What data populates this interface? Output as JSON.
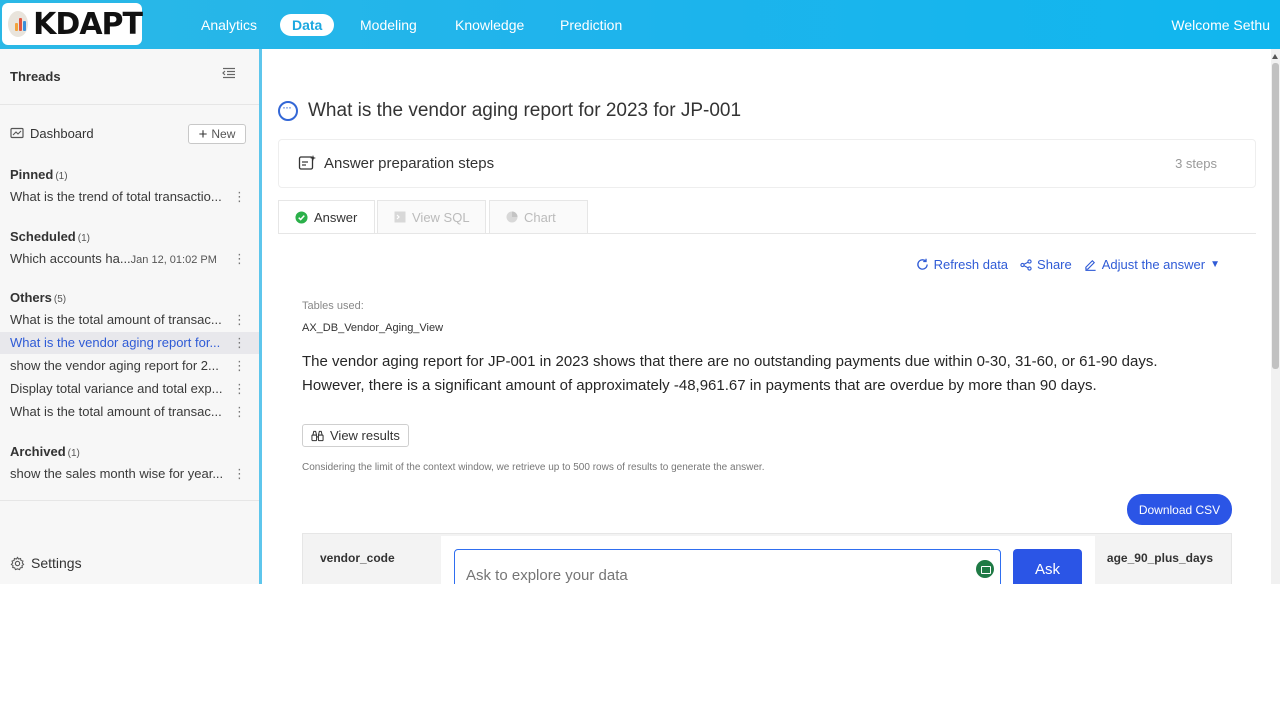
{
  "app": {
    "brand": "KDAPT",
    "welcome": "Welcome Sethu"
  },
  "nav": {
    "analytics": "Analytics",
    "data": "Data",
    "modeling": "Modeling",
    "knowledge": "Knowledge",
    "prediction": "Prediction"
  },
  "sidebar": {
    "threads": "Threads",
    "dashboard": "Dashboard",
    "new": "New",
    "pinned": {
      "label": "Pinned",
      "count": "(1)",
      "items": [
        "What is the trend of total transactio..."
      ]
    },
    "scheduled": {
      "label": "Scheduled",
      "count": "(1)",
      "items": [
        {
          "text": "Which accounts ha...",
          "date": "Jan 12, 01:02 PM"
        }
      ]
    },
    "others": {
      "label": "Others",
      "count": "(5)",
      "items": [
        "What is the total amount of transac...",
        "What is the vendor aging report for...",
        "show the vendor aging report for 2...",
        "Display total variance and total exp...",
        "What is the total amount of transac..."
      ]
    },
    "archived": {
      "label": "Archived",
      "count": "(1)",
      "items": [
        "show the sales month wise for year..."
      ]
    },
    "settings": "Settings"
  },
  "main": {
    "question": "What is the vendor aging report for 2023 for JP-001",
    "steps_label": "Answer preparation steps",
    "steps_count": "3 steps",
    "tabs": [
      "Answer",
      "View SQL",
      "Chart"
    ],
    "actions": {
      "refresh": "Refresh data",
      "share": "Share",
      "adjust": "Adjust the answer"
    },
    "tables_used_label": "Tables used:",
    "table_name": "AX_DB_Vendor_Aging_View",
    "summary": "The vendor aging report for JP-001 in 2023 shows that there are no outstanding payments due within 0-30, 31-60, or 61-90 days. However, there is a significant amount of approximately -48,961.67 in payments that are overdue by more than 90 days.",
    "view_results": "View results",
    "context_note": "Considering the limit of the context window, we retrieve up to 500 rows of results to generate the answer.",
    "download_csv": "Download CSV",
    "columns": [
      "vendor_code",
      "age_90_plus_days"
    ]
  },
  "ask": {
    "placeholder": "Ask to explore your data",
    "button": "Ask"
  },
  "colors": {
    "accent": "#2b55e6",
    "topbar": "#1fb4ec",
    "link": "#2f5bd6"
  }
}
